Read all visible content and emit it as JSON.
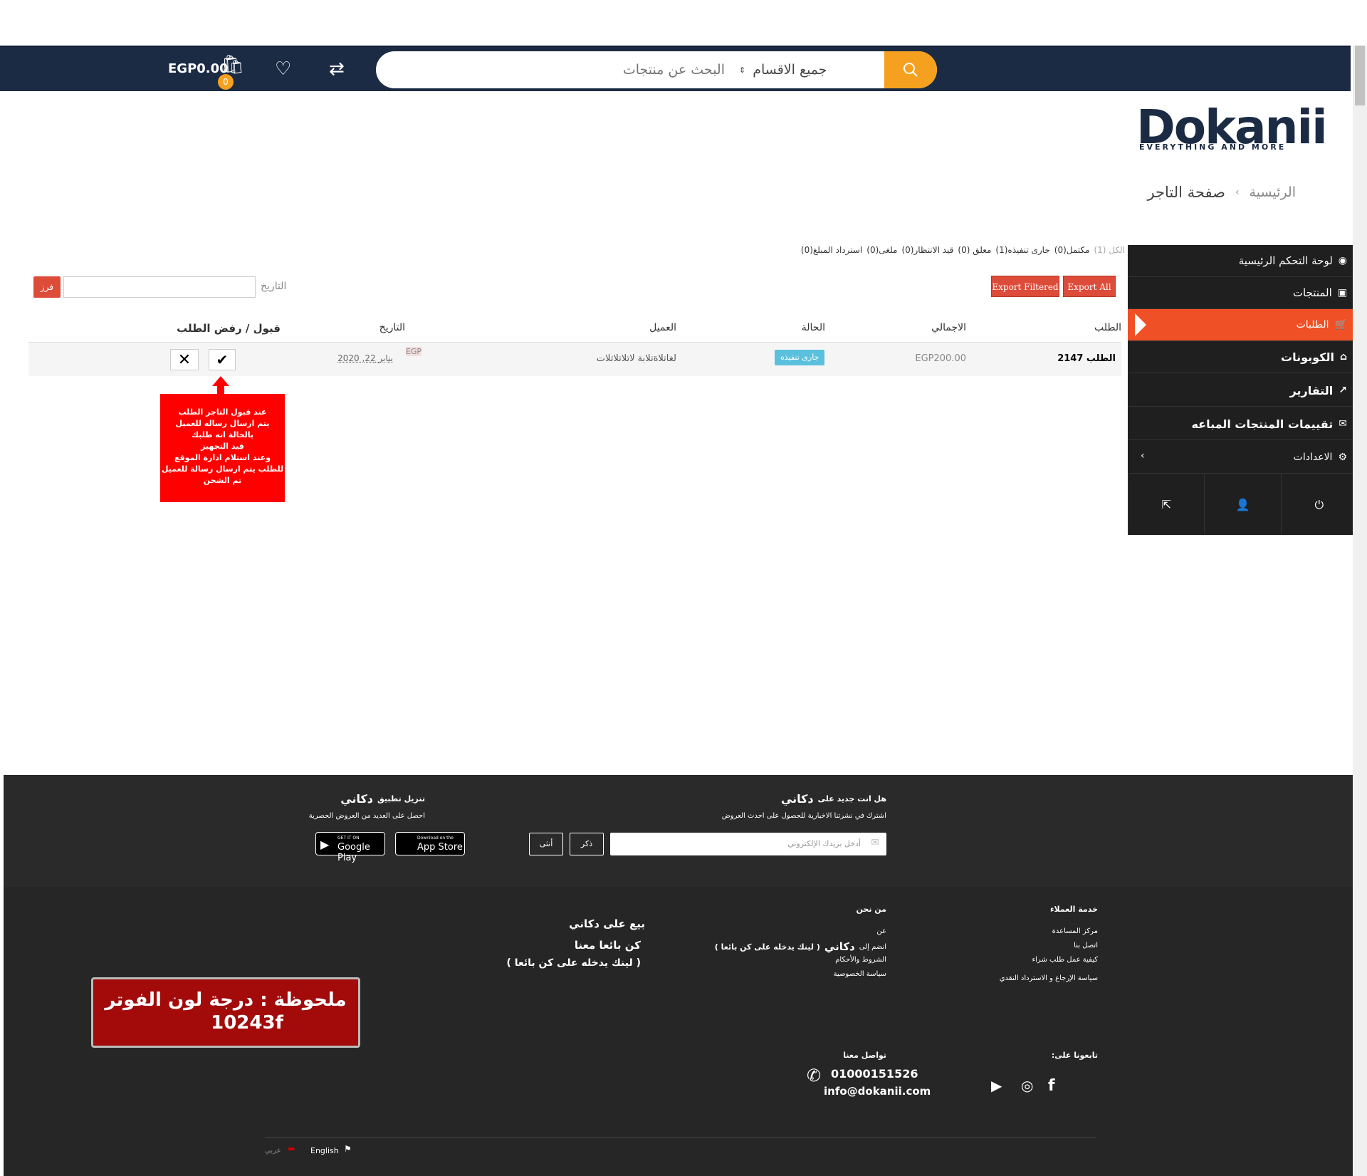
{
  "header": {
    "search_placeholder": "البحث عن منتجات",
    "category_select": "جميع الاقسام",
    "cart_total": "EGP0.00",
    "cart_count": "0"
  },
  "logo": {
    "brand": "Dokanii",
    "tagline": "EVERYTHING AND MORE"
  },
  "breadcrumb": {
    "home": "الرئيسية",
    "separator": "›",
    "current": "صفحة التاجر"
  },
  "sidebar": {
    "items": [
      {
        "label": "لوحة التحكم الرئيسية",
        "icon": "dashboard-icon"
      },
      {
        "label": "المنتجات",
        "icon": "briefcase-icon"
      },
      {
        "label": "الطلبات",
        "icon": "cart-icon",
        "active": true
      },
      {
        "label": "الكوبونات",
        "icon": "gift-icon"
      },
      {
        "label": "التقارير",
        "icon": "chart-icon"
      },
      {
        "label": "تقييمات المنتجات المباعه",
        "icon": "comments-icon"
      },
      {
        "label": "الاعدادات",
        "icon": "gear-icon"
      }
    ]
  },
  "filters": {
    "statuses": [
      "الكل (1)",
      "مكتمل(0)",
      "جارى تنفيذه(1)",
      "معلق (0)",
      "قيد الانتظار(0)",
      "ملغى(0)",
      "استرداد المبلغ(0)"
    ],
    "export_all": "Export All",
    "export_filtered": "Export Filtered",
    "date_label": "التاريخ",
    "filter_button": "فرز"
  },
  "table": {
    "headers": {
      "order": "الطلب",
      "total": "الاجمالي",
      "status": "الحالة",
      "customer": "العميل",
      "date": "التاريخ",
      "action": "قبول / رفض الطلب"
    },
    "rows": [
      {
        "order": "الطلب 2147",
        "total": "EGP200.00",
        "status": "جارى تنفيذه",
        "customer": "لغاتلاةتلابة لاتلاتلاتلات",
        "date": "يناير 22, 2020",
        "date_tag": "EGP"
      }
    ]
  },
  "annotation": {
    "lines": [
      "عند قبول التاجر الطلب",
      "يتم ارسال رساله للعميل",
      "بالحالة انه طلبك",
      "قيد التجهيز",
      "وعند استلام ادارة الموقع",
      "للطلب يتم ارسال رسالة للعميل",
      "تم الشحن"
    ]
  },
  "footer": {
    "newsletter_title": "هل انت جديد على",
    "brand_ar": "دكاني",
    "newsletter_sub": "اشترك في نشرتنا الاخبارية للحصول على احدث العروض",
    "email_placeholder": "أدخل بريدك الإلكتروني",
    "male": "ذكر",
    "female": "أنثى",
    "app_title": "تنزيل تطبيق",
    "app_sub": "احصل على العديد من العروض الحصرية",
    "appstore_small": "Download on the",
    "appstore_big": "App Store",
    "googleplay_small": "GET IT ON",
    "googleplay_big": "Google Play",
    "customer_service": {
      "title": "خدمة العملاء",
      "links": [
        "مركز المساعدة",
        "اتصل بنا",
        "كيفية عمل طلب شراء",
        "سياسة الإرجاع و الاسترداد النقدي"
      ]
    },
    "about": {
      "title": "من نحن",
      "links": [
        "عن",
        "انضم إلى",
        "الشروط والأحكام",
        "سياسة الخصوصية"
      ],
      "join_extra": "( لينك يدخله على كن بائعا )"
    },
    "sell": {
      "line1": "بيع على دكاني",
      "line2": "كن بائعا معنا",
      "line3": "( لينك يدخله على كن بائعا )"
    },
    "note": {
      "line1": "ملحوظة : درجة لون الفوتر",
      "line2": "10243f"
    },
    "follow_title": "تابعونا على:",
    "contact_title": "تواصل معنا",
    "phone": "01000151526",
    "email": "info@dokanii.com",
    "lang_en": "English",
    "lang_ar": "عربي"
  }
}
